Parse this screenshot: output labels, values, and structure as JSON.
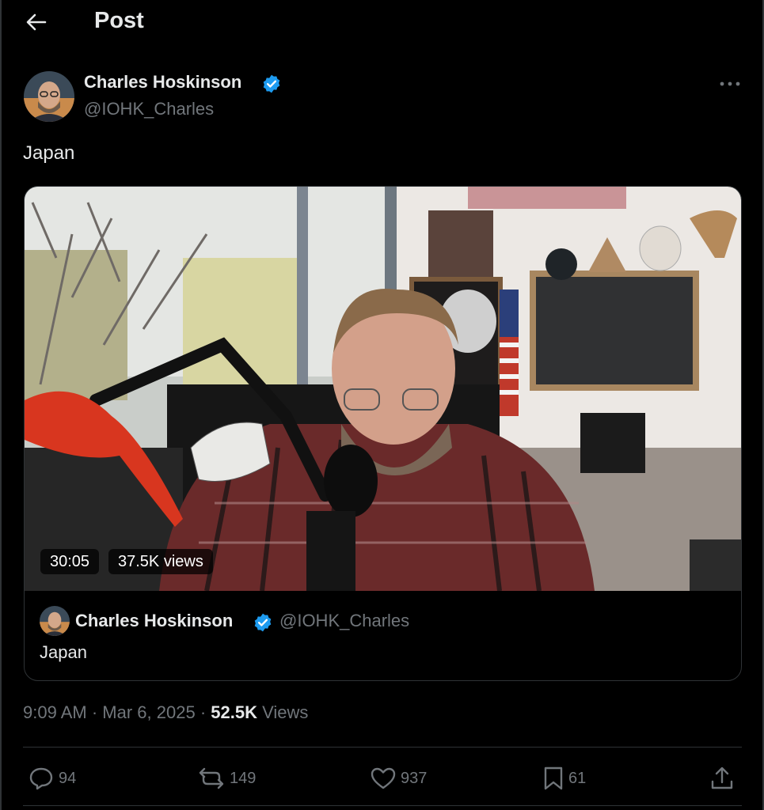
{
  "header": {
    "title": "Post"
  },
  "post": {
    "author": {
      "name": "Charles Hoskinson",
      "handle": "@IOHK_Charles",
      "verified": true
    },
    "text": "Japan",
    "media": {
      "type": "video",
      "duration": "30:05",
      "views": "37.5K views"
    },
    "quoted": {
      "author": {
        "name": "Charles Hoskinson",
        "handle": "@IOHK_Charles",
        "verified": true
      },
      "text": "Japan"
    },
    "meta": {
      "time": "9:09 AM",
      "date": "Mar 6, 2025",
      "views_count": "52.5K",
      "views_label": "Views"
    },
    "actions": {
      "replies": "94",
      "reposts": "149",
      "likes": "937",
      "bookmarks": "61"
    }
  },
  "colors": {
    "background": "#000000",
    "text_primary": "#e7e9ea",
    "text_secondary": "#71767b",
    "verified": "#1d9bf0",
    "border": "#2f3336"
  },
  "icons": [
    "back-arrow-icon",
    "verified-badge-icon",
    "more-icon",
    "reply-icon",
    "repost-icon",
    "like-icon",
    "bookmark-icon",
    "share-icon"
  ]
}
